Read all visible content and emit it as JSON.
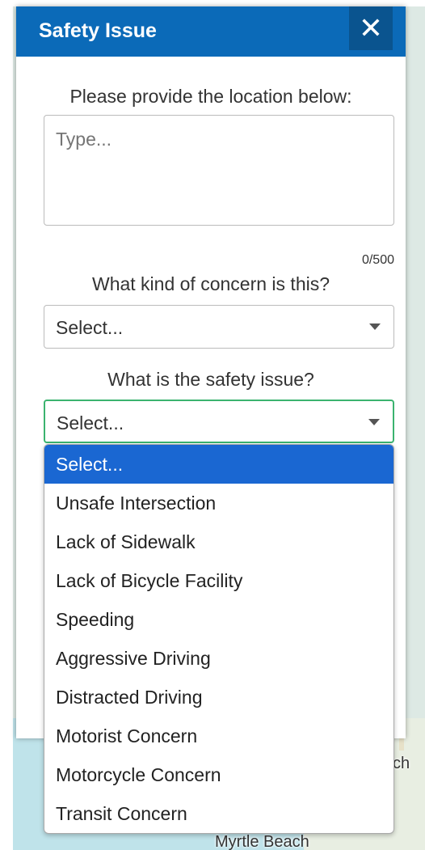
{
  "panel": {
    "title": "Safety Issue",
    "close_glyph": "✕"
  },
  "location": {
    "label": "Please provide the location below:",
    "placeholder": "Type...",
    "value": "",
    "counter": "0/500"
  },
  "concern_kind": {
    "label": "What kind of concern is this?",
    "selected": "Select..."
  },
  "safety_issue": {
    "label": "What is the safety issue?",
    "selected": "Select...",
    "options": [
      "Select...",
      "Unsafe Intersection",
      "Lack of Sidewalk",
      "Lack of Bicycle Facility",
      "Speeding",
      "Aggressive Driving",
      "Distracted Driving",
      "Motorist Concern",
      "Motorcycle Concern",
      "Transit Concern"
    ],
    "highlighted_index": 0
  },
  "map": {
    "labels": [
      "ch",
      "Myrtle Beach"
    ]
  },
  "colors": {
    "header": "#0b6ab8",
    "close_bg": "#0a548f",
    "focus_border": "#3bb36f",
    "option_highlight": "#1a67d2"
  },
  "icons": {
    "close": "close-icon",
    "caret": "chevron-down-icon"
  }
}
